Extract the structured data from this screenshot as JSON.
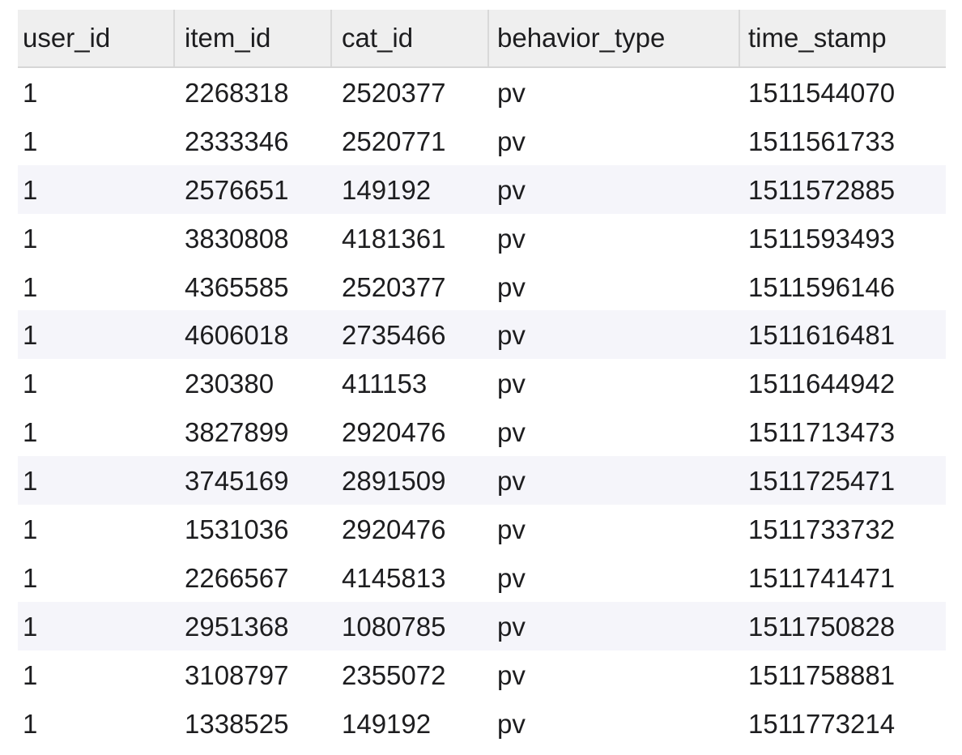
{
  "table": {
    "columns": [
      "user_id",
      "item_id",
      "cat_id",
      "behavior_type",
      "time_stamp"
    ],
    "rows": [
      [
        "1",
        "2268318",
        "2520377",
        "pv",
        "1511544070"
      ],
      [
        "1",
        "2333346",
        "2520771",
        "pv",
        "1511561733"
      ],
      [
        "1",
        "2576651",
        "149192",
        "pv",
        "1511572885"
      ],
      [
        "1",
        "3830808",
        "4181361",
        "pv",
        "1511593493"
      ],
      [
        "1",
        "4365585",
        "2520377",
        "pv",
        "1511596146"
      ],
      [
        "1",
        "4606018",
        "2735466",
        "pv",
        "1511616481"
      ],
      [
        "1",
        "230380",
        "411153",
        "pv",
        "1511644942"
      ],
      [
        "1",
        "3827899",
        "2920476",
        "pv",
        "1511713473"
      ],
      [
        "1",
        "3745169",
        "2891509",
        "pv",
        "1511725471"
      ],
      [
        "1",
        "1531036",
        "2920476",
        "pv",
        "1511733732"
      ],
      [
        "1",
        "2266567",
        "4145813",
        "pv",
        "1511741471"
      ],
      [
        "1",
        "2951368",
        "1080785",
        "pv",
        "1511750828"
      ],
      [
        "1",
        "3108797",
        "2355072",
        "pv",
        "1511758881"
      ],
      [
        "1",
        "1338525",
        "149192",
        "pv",
        "1511773214"
      ]
    ],
    "striped_rows": [
      2,
      5,
      8,
      11
    ]
  }
}
